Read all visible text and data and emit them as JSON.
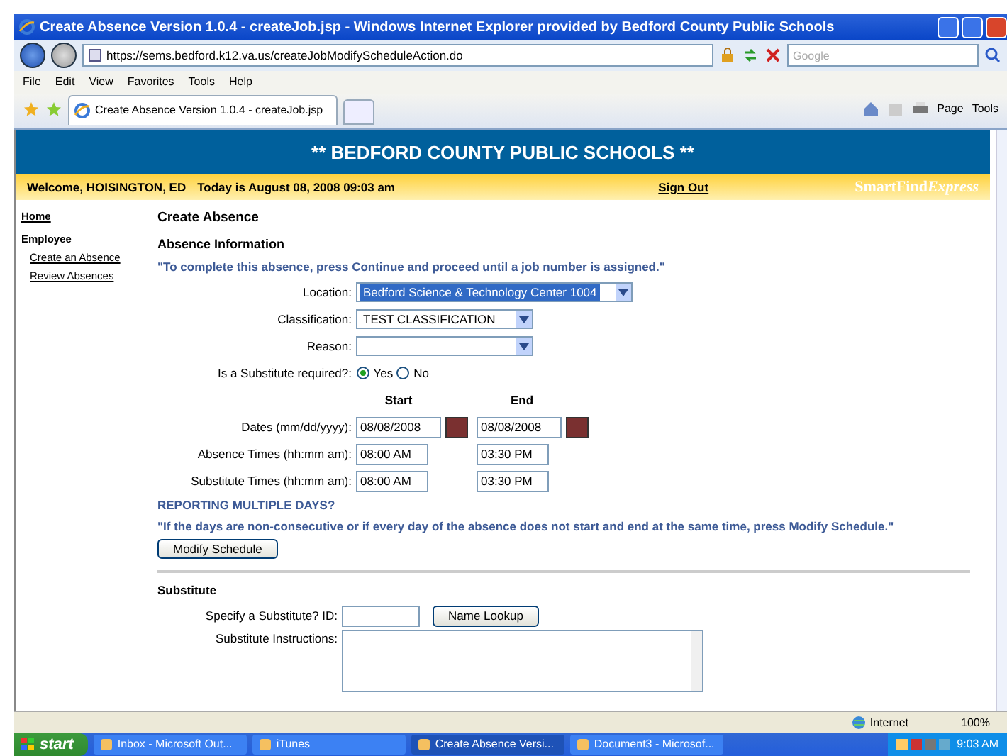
{
  "window": {
    "title": "Create Absence Version 1.0.4 - createJob.jsp - Windows Internet Explorer provided by Bedford County Public Schools"
  },
  "address_bar": {
    "url": "https://sems.bedford.k12.va.us/createJobModifyScheduleAction.do",
    "search_placeholder": "Google"
  },
  "menu": [
    "File",
    "Edit",
    "View",
    "Favorites",
    "Tools",
    "Help"
  ],
  "tabs": [
    {
      "label": "Create Absence Version 1.0.4 - createJob.jsp",
      "selected": true
    }
  ],
  "command_bar": [
    "Page",
    "Tools"
  ],
  "banner": {
    "title": "** BEDFORD COUNTY PUBLIC SCHOOLS **"
  },
  "welcome_bar": {
    "welcome": "Welcome, HOISINGTON, ED",
    "today": "Today is August 08, 2008 09:03 am",
    "sign_out": "Sign Out",
    "logo": {
      "name": "SmartFind",
      "suffix": "Express"
    }
  },
  "sidebar": {
    "home": "Home",
    "section": "Employee",
    "items": [
      "Create an Absence",
      "Review Absences"
    ]
  },
  "form": {
    "heading": "Create Absence",
    "section": "Absence Information",
    "instruction": "\"To complete this absence, press Continue and proceed until a job number is assigned.\"",
    "selects": [
      {
        "label": "Location:",
        "value": "Bedford Science & Technology Center 1004",
        "highlighted": true
      },
      {
        "label": "Classification:",
        "value": "TEST CLASSIFICATION"
      },
      {
        "label": "Reason:"
      }
    ],
    "substitute_required": {
      "label": "Is a Substitute required?:",
      "options": [
        {
          "label": "Yes",
          "selected": true
        },
        {
          "label": "No",
          "selected": false
        }
      ]
    },
    "columns": [
      "Start",
      "End"
    ],
    "time_rows": [
      {
        "label": "Dates (mm/dd/yyyy):",
        "start": "08/08/2008",
        "end": "08/08/2008",
        "kind": "date"
      },
      {
        "label": "Absence Times (hh:mm am):",
        "start": "08:00 AM",
        "end": "03:30 PM",
        "kind": "time"
      },
      {
        "label": "Substitute Times  (hh:mm am):",
        "start": "08:00 AM",
        "end": "03:30 PM",
        "kind": "time"
      }
    ],
    "multiple_days_heading": "REPORTING MULTIPLE DAYS?",
    "multiple_days_note": "\"If the days are non-consecutive or if every day of the absence does not start and end at the same time, press Modify Schedule.\"",
    "modify_button": "Modify Schedule",
    "substitute_section": "Substitute",
    "specify_label": "Specify a Substitute? ID:",
    "lookup_button": "Name Lookup",
    "instructions_label": "Substitute Instructions:"
  },
  "status_bar": {
    "zone": "Internet",
    "zoom": "100%"
  },
  "taskbar": {
    "start": "start",
    "items": [
      {
        "label": "Inbox - Microsoft Out...",
        "selected": false
      },
      {
        "label": "iTunes",
        "selected": false
      },
      {
        "label": "Create Absence Versi...",
        "selected": true
      },
      {
        "label": "Document3 - Microsof...",
        "selected": false
      }
    ],
    "clock": "9:03 AM"
  }
}
